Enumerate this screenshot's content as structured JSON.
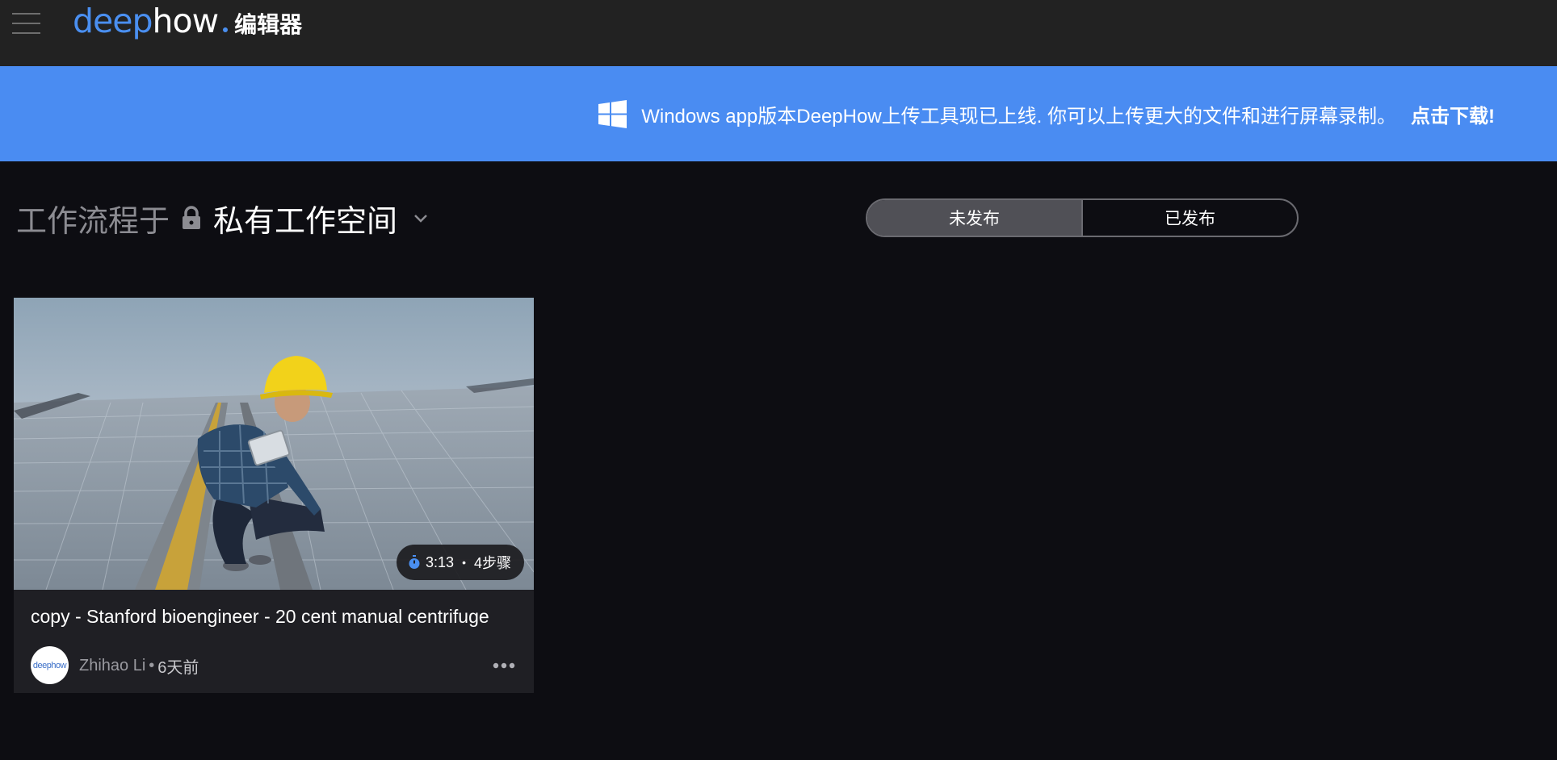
{
  "app": {
    "logo_deep": "deep",
    "logo_how": "how",
    "logo_suffix": "编辑器",
    "accent_color": "#4a8ff0"
  },
  "banner": {
    "text": "Windows app版本DeepHow上传工具现已上线. 你可以上传更大的文件和进行屏幕录制。",
    "link_label": "点击下载!",
    "background_color": "#4a8cf2",
    "icon": "windows-icon"
  },
  "workspace": {
    "prefix": "工作流程于",
    "name": "私有工作空间",
    "lock_icon": "lock-icon",
    "chevron_icon": "chevron-down-icon"
  },
  "tabs": {
    "unpublished": "未发布",
    "published": "已发布",
    "active": "unpublished"
  },
  "cards": [
    {
      "title": "copy - Stanford bioengineer - 20 cent manual centrifuge",
      "duration": "3:13",
      "steps": "4步骤",
      "author": "Zhihao Li",
      "time_ago": "6天前",
      "avatar_text": "deephow",
      "more_icon": "more-horizontal-icon",
      "timer_icon": "timer-icon"
    }
  ]
}
